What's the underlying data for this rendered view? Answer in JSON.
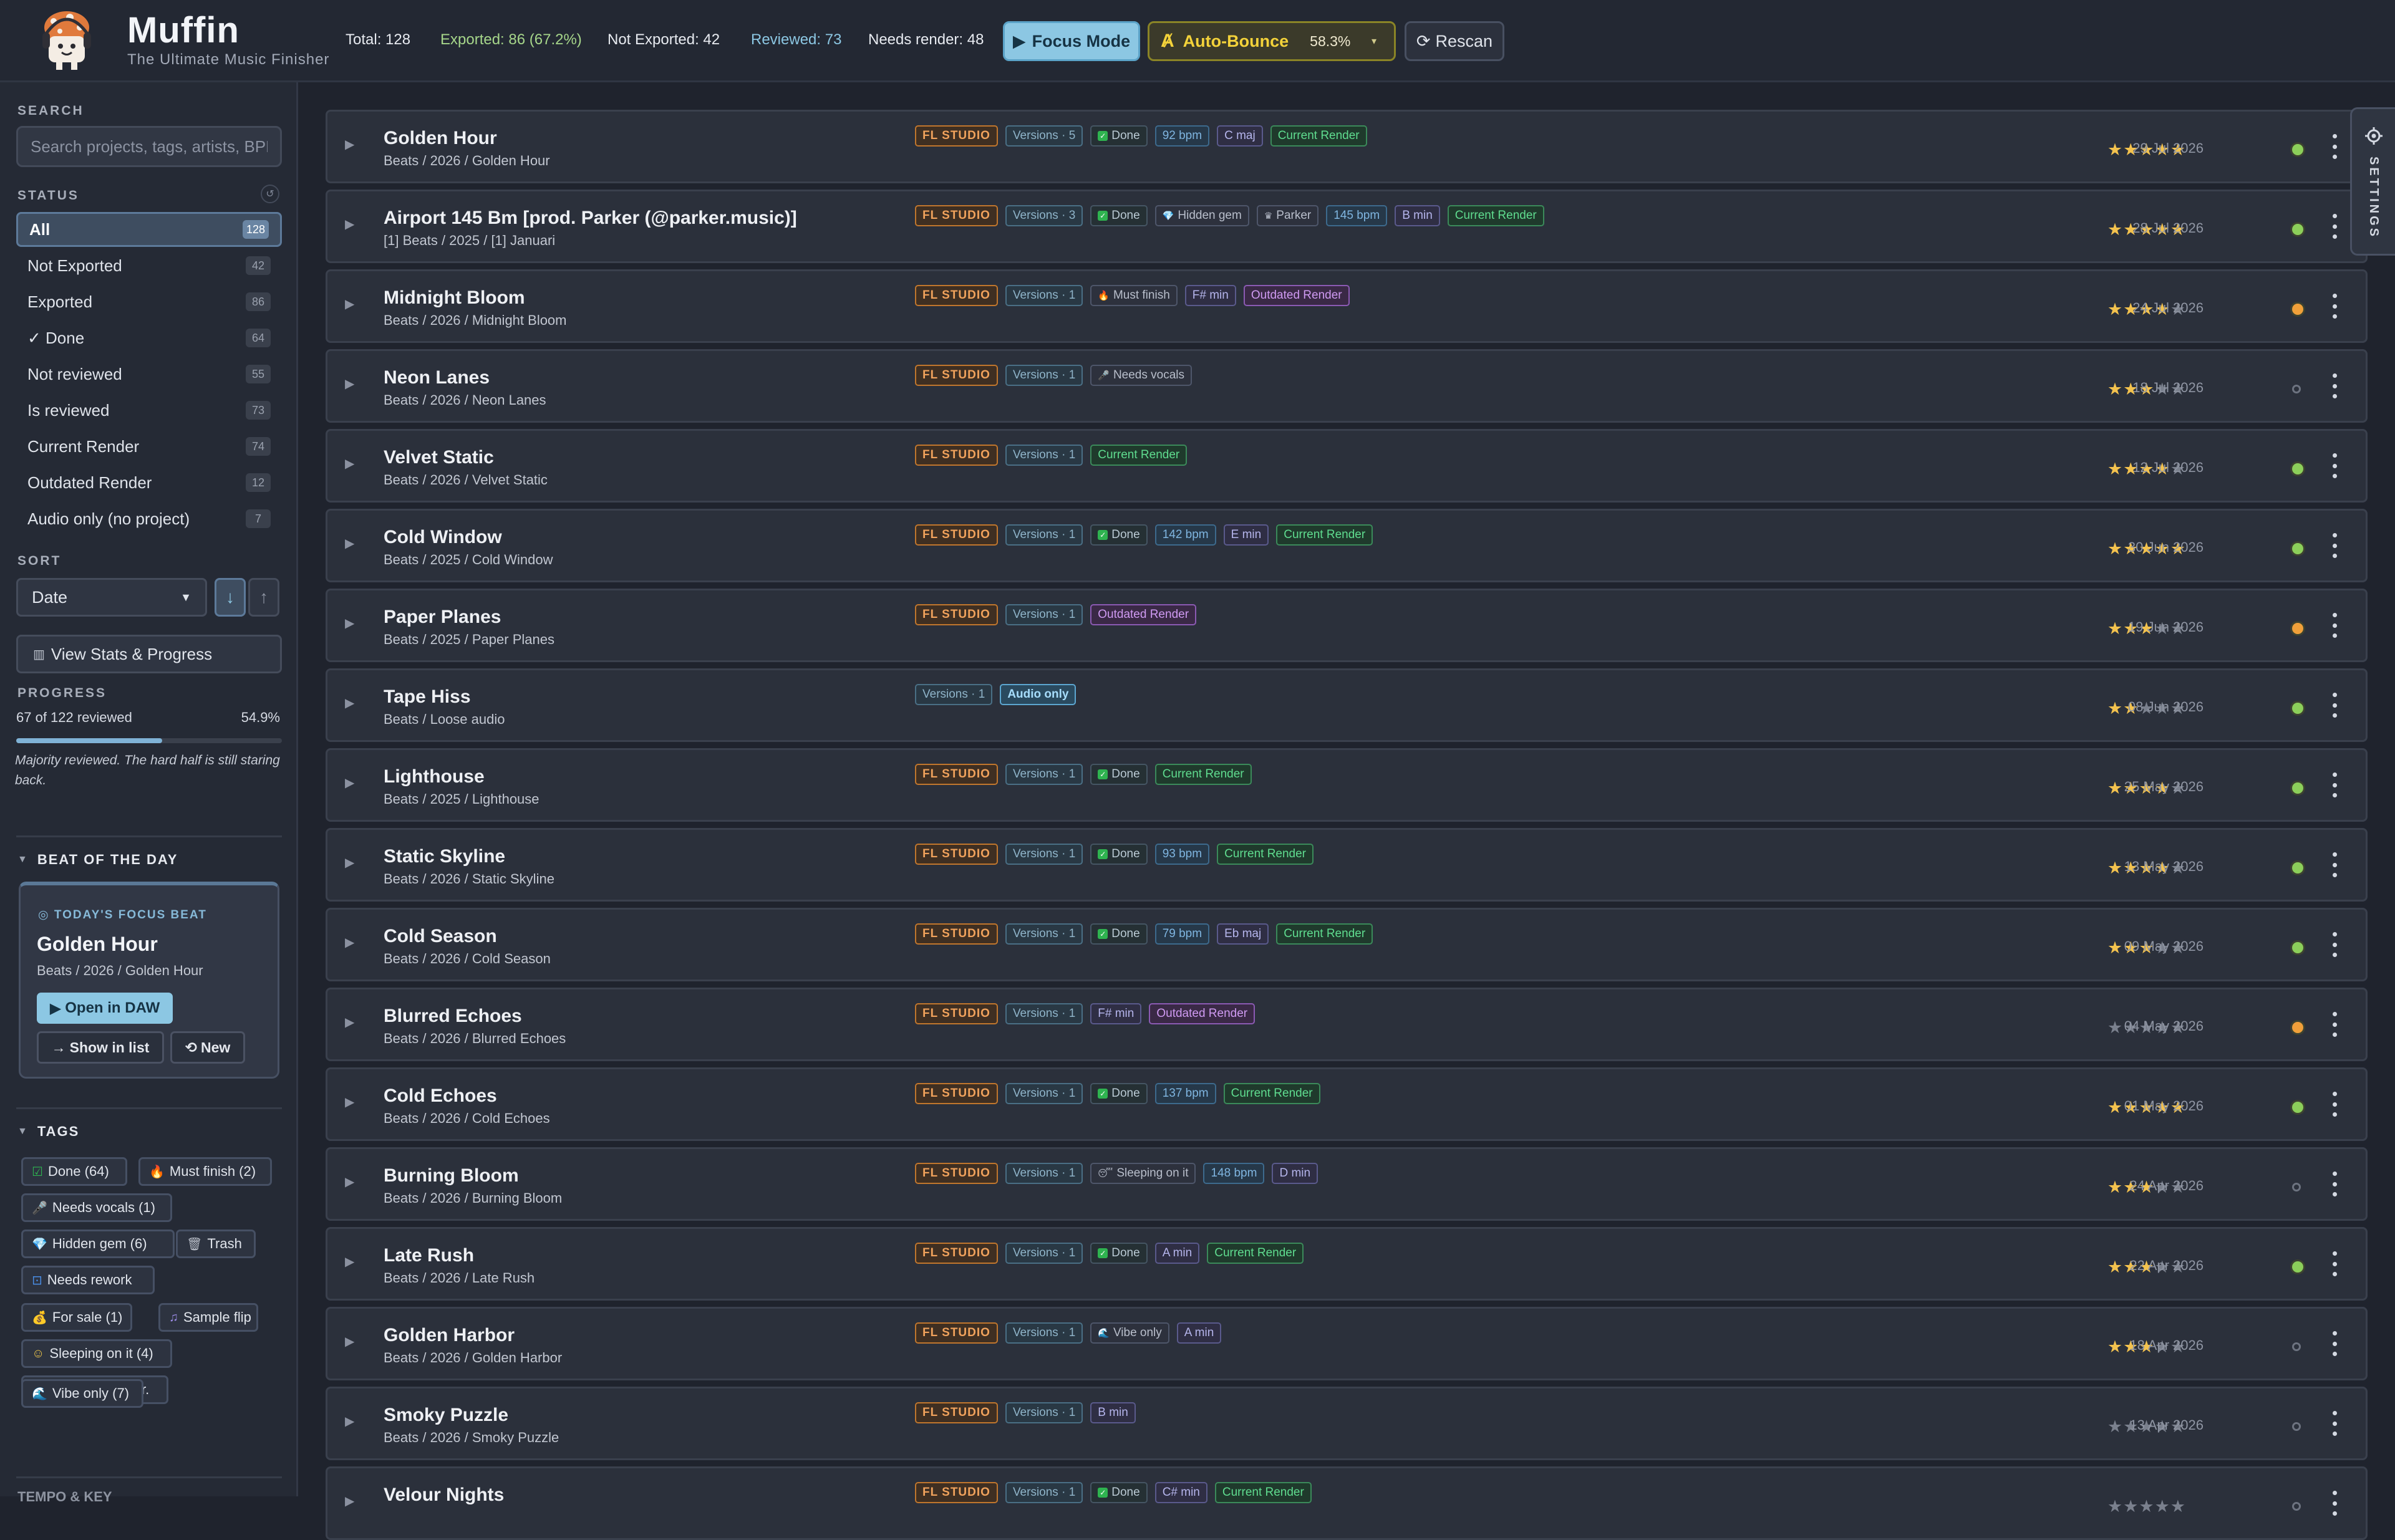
{
  "app": {
    "name": "Muffin",
    "tagline": "The Ultimate Music Finisher"
  },
  "header": {
    "total": "Total: 128",
    "exported": "Exported: 86 (67.2%)",
    "not_exported": "Not Exported: 42",
    "reviewed": "Reviewed: 73",
    "needs_render": "Needs render: 48",
    "focus_mode": "Focus Mode",
    "auto_bounce": "Auto-Bounce",
    "auto_bounce_pct": "58.3%",
    "rescan": "Rescan",
    "colors": {
      "exported": "#a6d68a",
      "reviewed": "#8cc7e3",
      "accent": "#8cc7e3",
      "autobounce": "#f3d23a"
    }
  },
  "sidebar": {
    "search_label": "SEARCH",
    "search_placeholder": "Search projects, tags, artists, BPM...",
    "status_label": "STATUS",
    "filters": [
      {
        "label": "All",
        "count": "128",
        "active": true
      },
      {
        "label": "Not Exported",
        "count": "42"
      },
      {
        "label": "Exported",
        "count": "86"
      },
      {
        "label": "✓ Done",
        "count": "64"
      },
      {
        "label": "Not reviewed",
        "count": "55"
      },
      {
        "label": "Is reviewed",
        "count": "73"
      },
      {
        "label": "Current Render",
        "count": "74"
      },
      {
        "label": "Outdated Render",
        "count": "12"
      },
      {
        "label": "Audio only (no project)",
        "count": "7"
      }
    ],
    "sort_label": "SORT",
    "sort_value": "Date",
    "stats_button": "View Stats & Progress",
    "progress_label": "PROGRESS",
    "progress_text": "67 of 122 reviewed",
    "progress_pct": "54.9%",
    "progress_fraction": 0.549,
    "progress_note": "Majority reviewed. The hard half is still staring back.",
    "beat_label": "BEAT OF THE DAY",
    "beat": {
      "label": "TODAY'S FOCUS BEAT",
      "title": "Golden Hour",
      "path": "Beats / 2026 / Golden Hour",
      "open": "Open in DAW",
      "show": "Show in list",
      "new": "New"
    },
    "tags_label": "TAGS",
    "tags": [
      {
        "icon": "checkbox-icon",
        "label": "Done (64)"
      },
      {
        "icon": "fire-icon",
        "label": "Must finish (2)"
      },
      {
        "icon": "microphone-icon",
        "label": "Needs vocals (1)"
      },
      {
        "icon": "gem-icon",
        "label": "Hidden gem (6)"
      },
      {
        "icon": "trash-icon",
        "label": "Trash"
      },
      {
        "icon": "rework-icon",
        "label": "Needs rework"
      },
      {
        "icon": "money-icon",
        "label": "For sale (1)"
      },
      {
        "icon": "music-note-icon",
        "label": "Sample flip"
      },
      {
        "icon": "sleep-icon",
        "label": "Sleeping on it (4)"
      },
      {
        "icon": "guitar-icon",
        "label": "Needs live instr."
      },
      {
        "icon": "wave-icon",
        "label": "Vibe only (7)"
      }
    ],
    "next_section": "TEMPO & KEY"
  },
  "settings_tab": "SETTINGS",
  "projects": [
    {
      "title": "Golden Hour",
      "path": "Beats / 2026 / Golden Hour",
      "fl": true,
      "versions": "Versions · 5",
      "badges": [
        {
          "t": "done",
          "l": "Done"
        },
        {
          "t": "bpm",
          "l": "92 bpm"
        },
        {
          "t": "key",
          "l": "C maj"
        },
        {
          "t": "cur",
          "l": "Current Render"
        }
      ],
      "stars": 5,
      "date": "29 Jul 2026",
      "status": "green"
    },
    {
      "title": "Airport 145 Bm [prod. Parker (@parker.music)]",
      "path": "[1] Beats / 2025 / [1] Januari",
      "fl": true,
      "versions": "Versions · 3",
      "badges": [
        {
          "t": "done",
          "l": "Done"
        },
        {
          "t": "tag",
          "l": "Hidden gem",
          "i": "💎"
        },
        {
          "t": "tag",
          "l": "Parker",
          "i": "♛"
        },
        {
          "t": "bpm",
          "l": "145 bpm"
        },
        {
          "t": "key",
          "l": "B min"
        },
        {
          "t": "cur",
          "l": "Current Render"
        }
      ],
      "stars": 5,
      "date": "28 Jul 2026",
      "status": "green"
    },
    {
      "title": "Midnight Bloom",
      "path": "Beats / 2026 / Midnight Bloom",
      "fl": true,
      "versions": "Versions · 1",
      "badges": [
        {
          "t": "tag",
          "l": "Must finish",
          "i": "🔥"
        },
        {
          "t": "key",
          "l": "F# min"
        },
        {
          "t": "out",
          "l": "Outdated Render"
        }
      ],
      "stars": 4,
      "date": "24 Jul 2026",
      "status": "orange"
    },
    {
      "title": "Neon Lanes",
      "path": "Beats / 2026 / Neon Lanes",
      "fl": true,
      "versions": "Versions · 1",
      "badges": [
        {
          "t": "tag",
          "l": "Needs vocals",
          "i": "🎤"
        }
      ],
      "stars": 3,
      "date": "18 Jul 2026",
      "status": "none"
    },
    {
      "title": "Velvet Static",
      "path": "Beats / 2026 / Velvet Static",
      "fl": true,
      "versions": "Versions · 1",
      "badges": [
        {
          "t": "cur",
          "l": "Current Render"
        }
      ],
      "stars": 4,
      "date": "12 Jul 2026",
      "status": "green"
    },
    {
      "title": "Cold Window",
      "path": "Beats / 2025 / Cold Window",
      "fl": true,
      "versions": "Versions · 1",
      "badges": [
        {
          "t": "done",
          "l": "Done"
        },
        {
          "t": "bpm",
          "l": "142 bpm"
        },
        {
          "t": "key",
          "l": "E min"
        },
        {
          "t": "cur",
          "l": "Current Render"
        }
      ],
      "stars": 5,
      "date": "30 Jun 2026",
      "status": "green"
    },
    {
      "title": "Paper Planes",
      "path": "Beats / 2025 / Paper Planes",
      "fl": true,
      "versions": "Versions · 1",
      "badges": [
        {
          "t": "out",
          "l": "Outdated Render"
        }
      ],
      "stars": 3,
      "date": "19 Jun 2026",
      "status": "orange"
    },
    {
      "title": "Tape Hiss",
      "path": "Beats / Loose audio",
      "fl": false,
      "versions": "Versions · 1",
      "badges": [
        {
          "t": "audio",
          "l": "Audio only"
        }
      ],
      "stars": 2,
      "date": "08 Jun 2026",
      "status": "green"
    },
    {
      "title": "Lighthouse",
      "path": "Beats / 2025 / Lighthouse",
      "fl": true,
      "versions": "Versions · 1",
      "badges": [
        {
          "t": "done",
          "l": "Done"
        },
        {
          "t": "cur",
          "l": "Current Render"
        }
      ],
      "stars": 4,
      "date": "25 May 2026",
      "status": "green"
    },
    {
      "title": "Static Skyline",
      "path": "Beats / 2026 / Static Skyline",
      "fl": true,
      "versions": "Versions · 1",
      "badges": [
        {
          "t": "done",
          "l": "Done"
        },
        {
          "t": "bpm",
          "l": "93 bpm"
        },
        {
          "t": "cur",
          "l": "Current Render"
        }
      ],
      "stars": 4,
      "date": "13 May 2026",
      "status": "green"
    },
    {
      "title": "Cold Season",
      "path": "Beats / 2026 / Cold Season",
      "fl": true,
      "versions": "Versions · 1",
      "badges": [
        {
          "t": "done",
          "l": "Done"
        },
        {
          "t": "bpm",
          "l": "79 bpm"
        },
        {
          "t": "key",
          "l": "Eb maj"
        },
        {
          "t": "cur",
          "l": "Current Render"
        }
      ],
      "stars": 3,
      "date": "09 May 2026",
      "status": "green"
    },
    {
      "title": "Blurred Echoes",
      "path": "Beats / 2026 / Blurred Echoes",
      "fl": true,
      "versions": "Versions · 1",
      "badges": [
        {
          "t": "key",
          "l": "F# min"
        },
        {
          "t": "out",
          "l": "Outdated Render"
        }
      ],
      "stars": 0,
      "date": "04 May 2026",
      "status": "orange"
    },
    {
      "title": "Cold Echoes",
      "path": "Beats / 2026 / Cold Echoes",
      "fl": true,
      "versions": "Versions · 1",
      "badges": [
        {
          "t": "done",
          "l": "Done"
        },
        {
          "t": "bpm",
          "l": "137 bpm"
        },
        {
          "t": "cur",
          "l": "Current Render"
        }
      ],
      "stars": 5,
      "date": "01 May 2026",
      "status": "green"
    },
    {
      "title": "Burning Bloom",
      "path": "Beats / 2026 / Burning Bloom",
      "fl": true,
      "versions": "Versions · 1",
      "badges": [
        {
          "t": "tag",
          "l": "Sleeping on it",
          "i": "😴"
        },
        {
          "t": "bpm",
          "l": "148 bpm"
        },
        {
          "t": "key",
          "l": "D min"
        }
      ],
      "stars": 3,
      "date": "24 Apr 2026",
      "status": "none"
    },
    {
      "title": "Late Rush",
      "path": "Beats / 2026 / Late Rush",
      "fl": true,
      "versions": "Versions · 1",
      "badges": [
        {
          "t": "done",
          "l": "Done"
        },
        {
          "t": "key",
          "l": "A min"
        },
        {
          "t": "cur",
          "l": "Current Render"
        }
      ],
      "stars": 3,
      "date": "22 Apr 2026",
      "status": "green"
    },
    {
      "title": "Golden Harbor",
      "path": "Beats / 2026 / Golden Harbor",
      "fl": true,
      "versions": "Versions · 1",
      "badges": [
        {
          "t": "tag",
          "l": "Vibe only",
          "i": "🌊"
        },
        {
          "t": "key",
          "l": "A min"
        }
      ],
      "stars": 3,
      "date": "18 Apr 2026",
      "status": "none"
    },
    {
      "title": "Smoky Puzzle",
      "path": "Beats / 2026 / Smoky Puzzle",
      "fl": true,
      "versions": "Versions · 1",
      "badges": [
        {
          "t": "key",
          "l": "B min"
        }
      ],
      "stars": 0,
      "date": "13 Apr 2026",
      "status": "none"
    },
    {
      "title": "Velour Nights",
      "path": "",
      "fl": true,
      "versions": "Versions · 1",
      "badges": [
        {
          "t": "done",
          "l": "Done"
        },
        {
          "t": "key",
          "l": "C# min"
        },
        {
          "t": "cur",
          "l": "Current Render"
        }
      ],
      "stars": 0,
      "date": "",
      "status": "none"
    }
  ]
}
